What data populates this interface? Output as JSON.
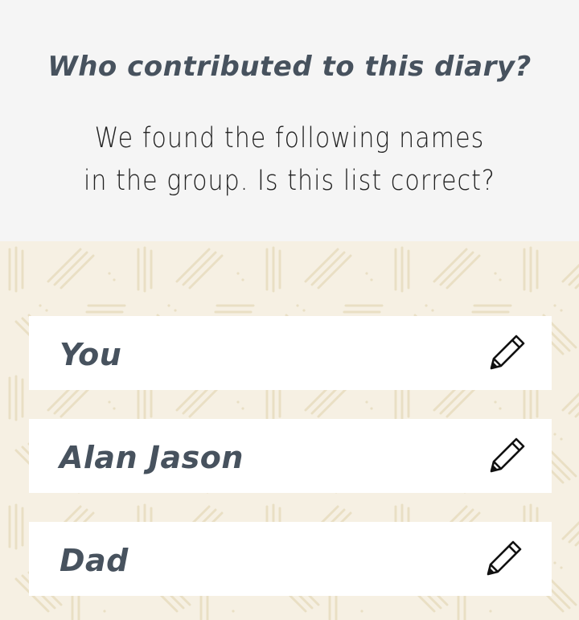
{
  "header": {
    "title": "Who contributed to this diary?",
    "subtitle": "We found the following names in the group. Is this list correct?"
  },
  "contributors": [
    {
      "name": "You",
      "action_icon": "pencil-icon"
    },
    {
      "name": "Alan Jason",
      "action_icon": "pencil-icon"
    },
    {
      "name": "Dad",
      "action_icon": "pencil-icon"
    }
  ],
  "colors": {
    "header_bg": "#f5f5f5",
    "pattern_bg": "#f6f0e3",
    "pattern_lines": "#e9dfc4",
    "text_primary": "#47525e",
    "text_body": "#222222",
    "card_bg": "#ffffff"
  }
}
